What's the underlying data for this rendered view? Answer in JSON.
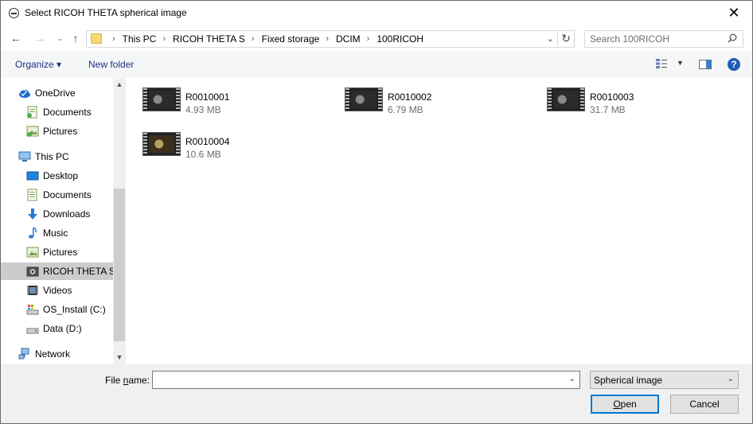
{
  "window": {
    "title": "Select RICOH THETA spherical image"
  },
  "address": {
    "crumbs": [
      "This PC",
      "RICOH THETA S",
      "Fixed storage",
      "DCIM",
      "100RICOH"
    ],
    "search_placeholder": "Search 100RICOH"
  },
  "toolbar": {
    "organize_label": "Organize ▾",
    "new_folder_label": "New folder"
  },
  "nav": {
    "onedrive": "OneDrive",
    "onedrive_documents": "Documents",
    "onedrive_pictures": "Pictures",
    "this_pc": "This PC",
    "desktop": "Desktop",
    "documents": "Documents",
    "downloads": "Downloads",
    "music": "Music",
    "pictures": "Pictures",
    "ricoh": "RICOH THETA S",
    "videos": "Videos",
    "os_install": "OS_Install (C:)",
    "data": "Data (D:)",
    "network": "Network"
  },
  "files": [
    {
      "name": "R0010001",
      "size": "4.93 MB"
    },
    {
      "name": "R0010002",
      "size": "6.79 MB"
    },
    {
      "name": "R0010003",
      "size": "31.7 MB"
    },
    {
      "name": "R0010004",
      "size": "10.6 MB"
    }
  ],
  "footer": {
    "filename_label_pre": "File ",
    "filename_label_ul": "n",
    "filename_label_post": "ame:",
    "filename_value": "",
    "file_type": "Spherical image",
    "open_ul": "O",
    "open_rest": "pen",
    "cancel_label": "Cancel"
  }
}
